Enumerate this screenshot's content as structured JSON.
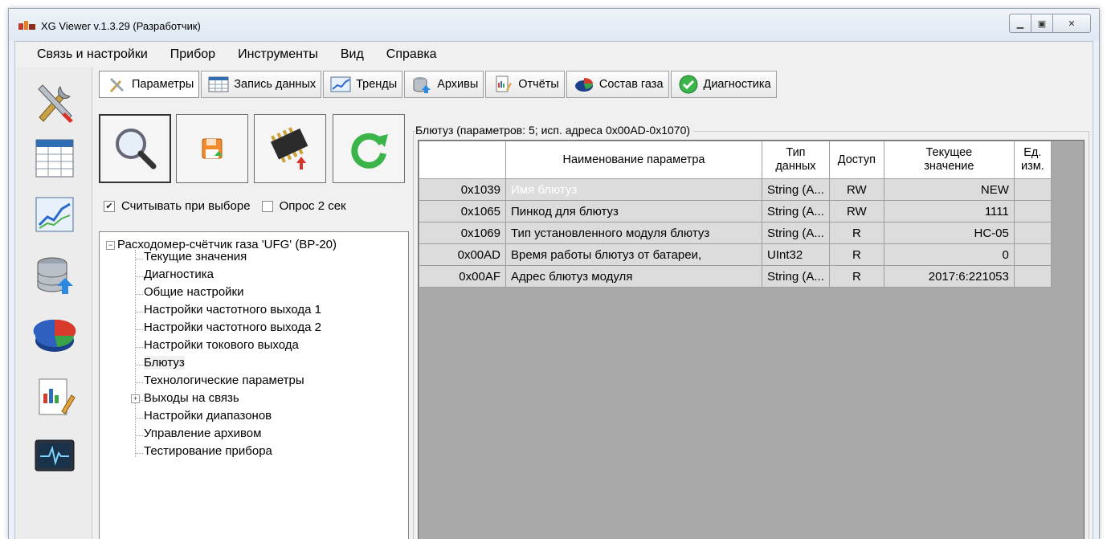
{
  "window": {
    "title": "XG Viewer v.1.3.29 (Разработчик)"
  },
  "menu": [
    "Связь и настройки",
    "Прибор",
    "Инструменты",
    "Вид",
    "Справка"
  ],
  "sidebar": {
    "icons": [
      "tools-icon",
      "table-icon",
      "trend-chart-icon",
      "database-upload-icon",
      "pie-chart-icon",
      "report-edit-icon",
      "monitor-pulse-icon"
    ]
  },
  "tabs": [
    {
      "label": "Параметры",
      "icon": "tools-icon",
      "active": true
    },
    {
      "label": "Запись данных",
      "icon": "table-icon"
    },
    {
      "label": "Тренды",
      "icon": "trend-chart-icon"
    },
    {
      "label": "Архивы",
      "icon": "database-upload-icon"
    },
    {
      "label": "Отчёты",
      "icon": "report-edit-icon"
    },
    {
      "label": "Состав газа",
      "icon": "pie-chart-icon"
    },
    {
      "label": "Диагностика",
      "icon": "check-circle-icon"
    }
  ],
  "toolbar": {
    "buttons": [
      "search-icon",
      "save-icon",
      "chip-upload-icon",
      "refresh-icon"
    ]
  },
  "options": {
    "read_on_select": {
      "label": "Считывать при выборе",
      "checked": true
    },
    "poll_2s": {
      "label": "Опрос 2 сек",
      "checked": false
    }
  },
  "tree": {
    "root": "Расходомер-счётчик газа 'UFG' (ВР-20)",
    "items": [
      "Текущие значения",
      "Диагностика",
      "Общие настройки",
      "Настройки частотного выхода 1",
      "Настройки частотного выхода 2",
      "Настройки токового выхода",
      "Блютуз",
      "Технологические параметры",
      "Выходы на связь",
      "Настройки диапазонов",
      "Управление архивом",
      "Тестирование прибора"
    ],
    "selected_index": 6,
    "expandable_index": 8
  },
  "group": {
    "label": "Блютуз (параметров: 5; исп. адреса 0x00AD-0x1070)"
  },
  "table": {
    "columns": [
      "",
      "Наименование параметра",
      "Тип данных",
      "Доступ",
      "Текущее значение",
      "Ед. изм."
    ],
    "rows": [
      {
        "addr": "0x1039",
        "name": "Имя блютуз",
        "type": "String (A...",
        "access": "RW",
        "value": "NEW",
        "unit": ""
      },
      {
        "addr": "0x1065",
        "name": "Пинкод для блютуз",
        "type": "String (A...",
        "access": "RW",
        "value": "1111",
        "unit": ""
      },
      {
        "addr": "0x1069",
        "name": "Тип установленного модуля блютуз",
        "type": "String (A...",
        "access": "R",
        "value": "HC-05",
        "unit": ""
      },
      {
        "addr": "0x00AD",
        "name": "Время работы блютуз от батареи,",
        "type": "UInt32",
        "access": "R",
        "value": "0",
        "unit": ""
      },
      {
        "addr": "0x00AF",
        "name": "Адрес блютуз модуля",
        "type": "String (A...",
        "access": "R",
        "value": "2017:6:221053",
        "unit": ""
      }
    ]
  },
  "colors": {
    "selection": "#3399ff",
    "grid_bg": "#a9a9a9",
    "cell_bg": "#dcdcdc"
  }
}
